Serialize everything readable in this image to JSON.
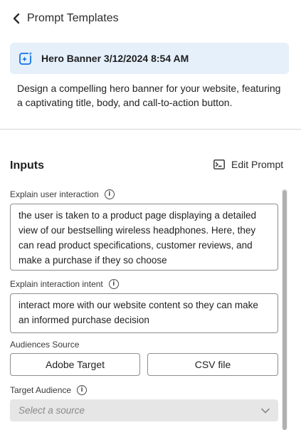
{
  "header": {
    "back_label": "Prompt Templates"
  },
  "template": {
    "title": "Hero Banner 3/12/2024 8:54 AM",
    "description": "Design a compelling hero banner for your website, featuring a captivating title, body, and call-to-action button."
  },
  "inputs": {
    "heading": "Inputs",
    "edit_prompt_label": "Edit Prompt",
    "user_interaction": {
      "label": "Explain user interaction",
      "value": "the user is taken to a product page displaying a detailed view of our bestselling wireless headphones. Here, they can read product specifications, customer reviews, and make a purchase if they so choose"
    },
    "interaction_intent": {
      "label": "Explain interaction intent",
      "value": "interact more with our website content so they can make an informed purchase decision"
    },
    "audiences_source": {
      "label": "Audiences Source",
      "options": [
        "Adobe Target",
        "CSV file"
      ]
    },
    "target_audience": {
      "label": "Target Audience",
      "placeholder": "Select a source"
    }
  },
  "colors": {
    "banner_bg": "#e5f0fb",
    "accent": "#2680eb",
    "divider": "#d5d5d5"
  }
}
